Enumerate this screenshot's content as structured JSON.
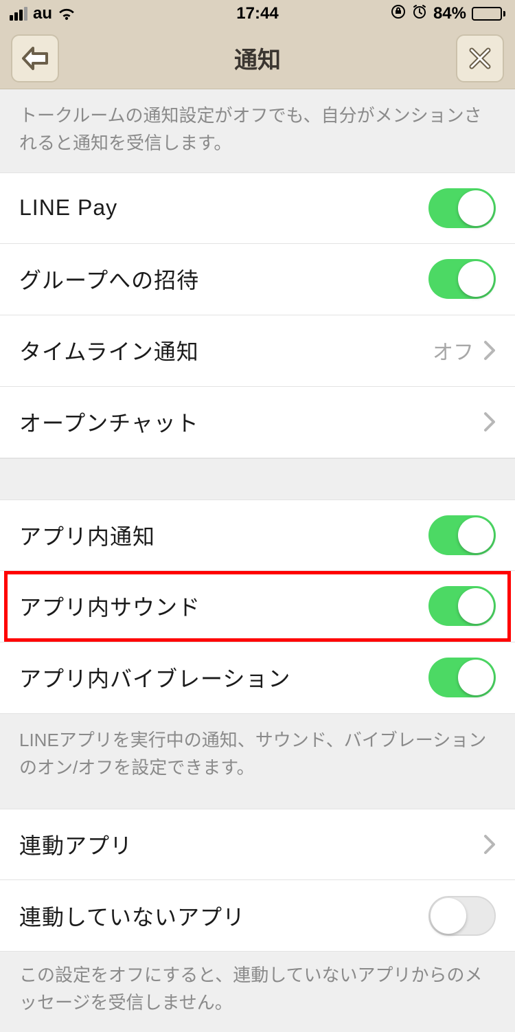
{
  "status": {
    "carrier": "au",
    "time": "17:44",
    "battery_pct": "84%"
  },
  "nav": {
    "title": "通知"
  },
  "section1": {
    "desc": "トークルームの通知設定がオフでも、自分がメンションされると通知を受信します。"
  },
  "rows1": [
    {
      "label": "LINE Pay"
    },
    {
      "label": "グループへの招待"
    },
    {
      "label": "タイムライン通知",
      "value": "オフ"
    },
    {
      "label": "オープンチャット"
    }
  ],
  "rows2": [
    {
      "label": "アプリ内通知"
    },
    {
      "label": "アプリ内サウンド"
    },
    {
      "label": "アプリ内バイブレーション"
    }
  ],
  "section2": {
    "desc": "LINEアプリを実行中の通知、サウンド、バイブレーションのオン/オフを設定できます。"
  },
  "rows3": [
    {
      "label": "連動アプリ"
    },
    {
      "label": "連動していないアプリ"
    }
  ],
  "section3": {
    "desc": "この設定をオフにすると、連動していないアプリからのメッセージを受信しません。"
  }
}
